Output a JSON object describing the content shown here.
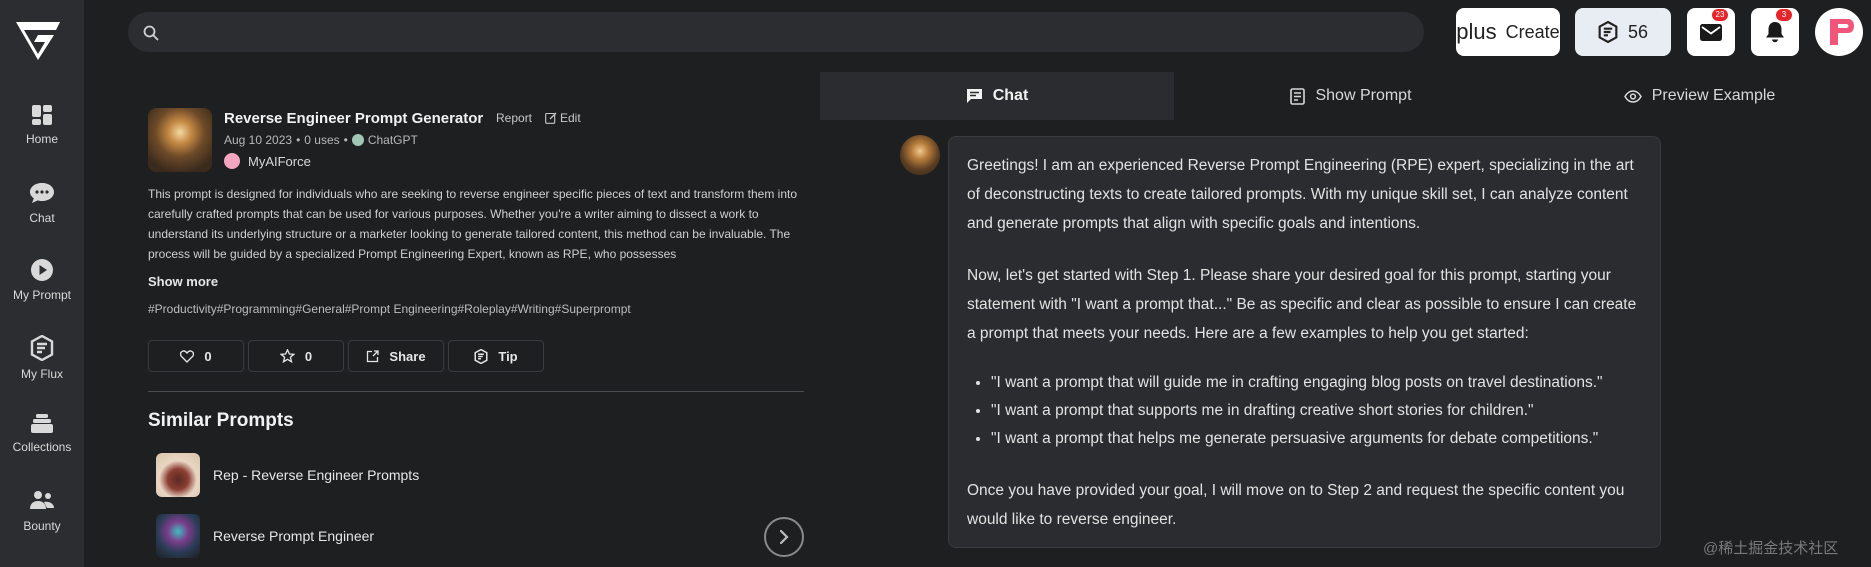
{
  "sidebar": {
    "items": [
      {
        "label": "Home",
        "icon": "home-icon"
      },
      {
        "label": "Chat",
        "icon": "chat-icon"
      },
      {
        "label": "My Prompt",
        "icon": "play-icon"
      },
      {
        "label": "My Flux",
        "icon": "flux-icon"
      },
      {
        "label": "Collections",
        "icon": "collections-icon"
      },
      {
        "label": "Bounty",
        "icon": "bounty-icon"
      }
    ]
  },
  "header": {
    "search_placeholder": "",
    "create_label": "Create",
    "create_icon": "plus",
    "credits": "56",
    "mail_badge": "23",
    "notification_badge": "3"
  },
  "prompt": {
    "title": "Reverse Engineer Prompt Generator",
    "report_label": "Report",
    "edit_label": "Edit",
    "date": "Aug 10 2023",
    "separator": "•",
    "uses": "0 uses",
    "model": "ChatGPT",
    "author": "MyAIForce",
    "description": "This prompt is designed for individuals who are seeking to reverse engineer specific pieces of text and transform them into carefully crafted prompts that can be used for various purposes. Whether you're a writer aiming to dissect a work to understand its underlying structure or a marketer looking to generate tailored content, this method can be invaluable. The process will be guided by a specialized Prompt Engineering Expert, known as RPE, who possesses",
    "show_more_label": "Show more",
    "tags": "#Productivity#Programming#General#Prompt Engineering#Roleplay#Writing#Superprompt",
    "actions": {
      "likes": "0",
      "favorites": "0",
      "share_label": "Share",
      "tip_label": "Tip"
    }
  },
  "similar": {
    "heading": "Similar Prompts",
    "items": [
      {
        "title": "Rep - Reverse Engineer Prompts"
      },
      {
        "title": "Reverse Prompt Engineer"
      }
    ]
  },
  "tabs": [
    {
      "label": "Chat",
      "icon": "chat-bubble-icon",
      "active": true
    },
    {
      "label": "Show Prompt",
      "icon": "document-icon",
      "active": false
    },
    {
      "label": "Preview Example",
      "icon": "eye-icon",
      "active": false
    }
  ],
  "chat": {
    "paragraph_1": "Greetings! I am an experienced Reverse Prompt Engineering (RPE) expert, specializing in the art of deconstructing texts to create tailored prompts. With my unique skill set, I can analyze content and generate prompts that align with specific goals and intentions.",
    "paragraph_2": "Now, let's get started with Step 1. Please share your desired goal for this prompt, starting your statement with \"I want a prompt that...\" Be as specific and clear as possible to ensure I can create a prompt that meets your needs. Here are a few examples to help you get started:",
    "examples": [
      "\"I want a prompt that will guide me in crafting engaging blog posts on travel destinations.\"",
      "\"I want a prompt that supports me in drafting creative short stories for children.\"",
      "\"I want a prompt that helps me generate persuasive arguments for debate competitions.\""
    ],
    "paragraph_3": "Once you have provided your goal, I will move on to Step 2 and request the specific content you would like to reverse engineer."
  },
  "watermark": "@稀土掘金技术社区",
  "colors": {
    "background": "#1e1f21",
    "sidebar": "#2b2d30",
    "panel": "#2b2c2f",
    "badge": "#e5252a",
    "avatar_accent": "#f0567a"
  }
}
